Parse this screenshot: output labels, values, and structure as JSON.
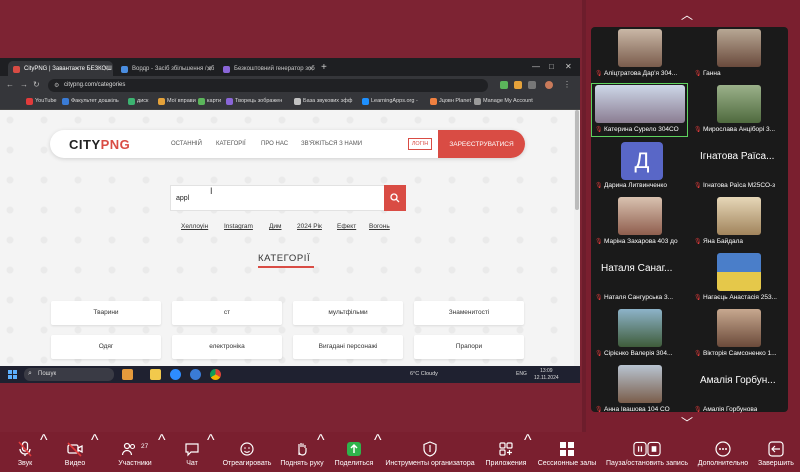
{
  "browser": {
    "tabs": [
      {
        "title": "CityPNG | Завантажте БЕЗКОШ"
      },
      {
        "title": "Вордр - Засіб збільшення / зб"
      },
      {
        "title": "Безкоштовний генератор зоб"
      }
    ],
    "url": "citypng.com/categories",
    "bookmarks": [
      "YouTube",
      "Факультет дошкіль",
      "диск",
      "Мої вправи",
      "карти",
      "Творець зображен",
      "База звукових эфф",
      "LearningApps.org -",
      "Јцовн Planet",
      "Manage My Account"
    ]
  },
  "site": {
    "logo_city": "CITY",
    "logo_png": "PNG",
    "nav": [
      "ОСТАННІЙ",
      "КАТЕГОРІЇ",
      "ПРО НАС",
      "ЗВ'ЯЖІТЬСЯ З НАМИ"
    ],
    "login": "ЛОГІН",
    "signup": "ЗАРЕЄСТРУВАТИСЯ",
    "search_value": "appl",
    "tags": [
      "Хеллоуін",
      "Instagram",
      "Дим",
      "2024 Рік",
      "Ефект",
      "Вогонь"
    ],
    "categories_title": "КАТЕГОРІЇ",
    "categories": [
      "Тварини",
      "ст",
      "мультфільми",
      "Знаменитості",
      "Одяг",
      "електроніка",
      "Вигадані персонажі",
      "Прапори"
    ]
  },
  "taskbar": {
    "search": "Пошук",
    "weather": "6°C  Cloudy",
    "lang": "ENG",
    "time": "13:09",
    "date": "12.11.2024"
  },
  "participants": [
    {
      "name": "Аліцтратова Дар'я 304...",
      "muted": true
    },
    {
      "name": "Ганна",
      "muted": true
    },
    {
      "name": "Катерина Сурело 304СО",
      "muted": true,
      "speaking": true
    },
    {
      "name": "Мирослава Анціборі 3...",
      "muted": true
    },
    {
      "name": "Дарина Литвинченко",
      "muted": true,
      "initial": "Д"
    },
    {
      "name": "Ігнатова Раїса М25СО-з",
      "muted": true,
      "display": "Ігнатова Раїса..."
    },
    {
      "name": "Маріна Захарова 403 до",
      "muted": true
    },
    {
      "name": "Яна Байдала",
      "muted": true
    },
    {
      "name": "Наталя Сангурська 3...",
      "muted": true,
      "display": "Наталя Санаг..."
    },
    {
      "name": "Нагаєць Анастасія 253...",
      "muted": true
    },
    {
      "name": "Сірієнко Валерія 304...",
      "muted": true
    },
    {
      "name": "Вікторія Самсоненко 1...",
      "muted": true
    },
    {
      "name": "Анна Івашова 104 СО",
      "muted": true
    },
    {
      "name": "Амалія Горбунова",
      "muted": true,
      "display": "Амалія Горбун..."
    }
  ],
  "toolbar": {
    "audio": "Звук",
    "video": "Видео",
    "participants": "Участники",
    "participants_count": "27",
    "chat": "Чат",
    "react": "Отреагировать",
    "raise_hand": "Поднять руку",
    "share": "Поделиться",
    "host_tools": "Инструменты организатора",
    "apps": "Приложения",
    "breakout": "Сессионные залы",
    "pause_record": "Пауза/остановить запись",
    "more": "Дополнительно",
    "end": "Завершить"
  }
}
